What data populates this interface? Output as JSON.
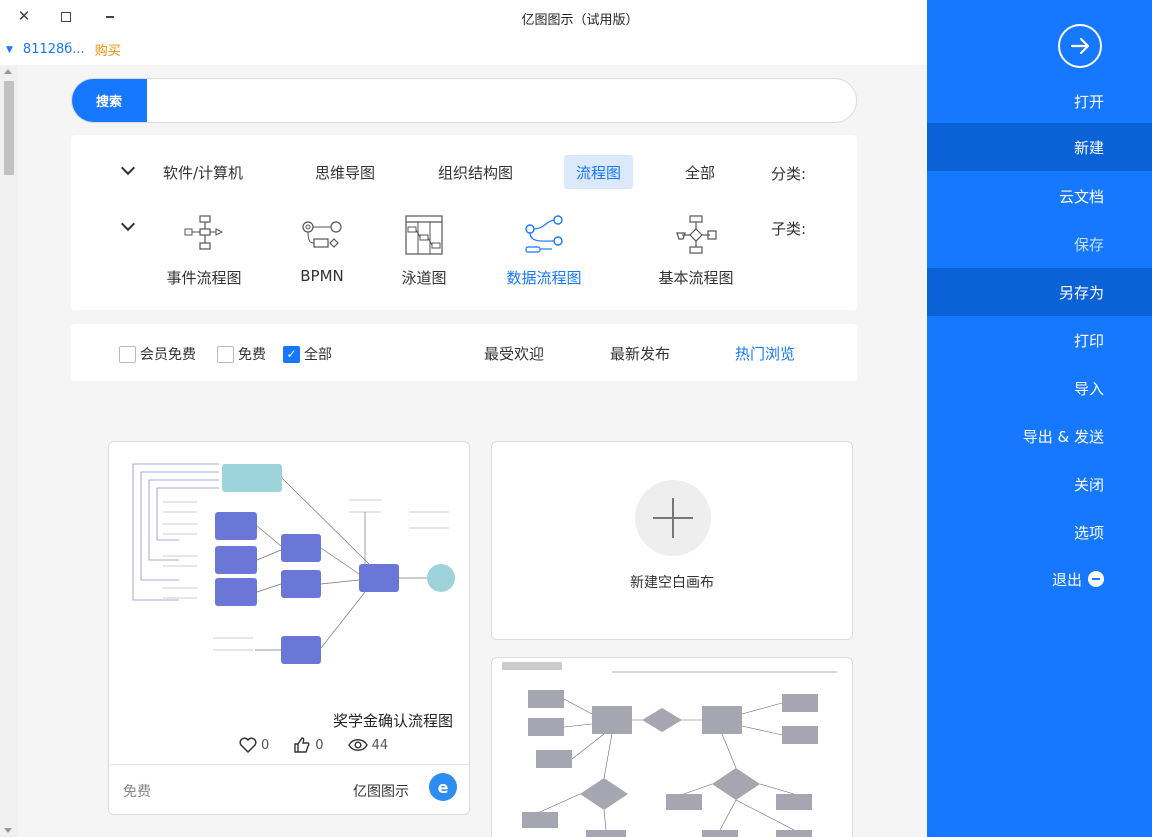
{
  "window": {
    "title": "亿图图示（试用版）",
    "close_symbol": "✕",
    "account": "81128б...",
    "buy": "购买"
  },
  "search": {
    "button": "搜索",
    "placeholder": ""
  },
  "filters": {
    "category_label": "分类:",
    "categories": [
      "全部",
      "流程图",
      "组织结构图",
      "思维导图",
      "软件/计算机"
    ],
    "active_category": "流程图",
    "subcategory_label": "子类:",
    "subcategories": [
      "基本流程图",
      "数据流程图",
      "泳道图",
      "BPMN",
      "事件流程图"
    ],
    "active_subcategory": "数据流程图"
  },
  "sort": {
    "tabs": [
      "热门浏览",
      "最新发布",
      "最受欢迎"
    ],
    "active_tab": "热门浏览",
    "checks": [
      {
        "label": "全部",
        "checked": true
      },
      {
        "label": "免费",
        "checked": false
      },
      {
        "label": "会员免费",
        "checked": false
      }
    ]
  },
  "cards": {
    "new_blank": "新建空白画布",
    "template": {
      "title": "奖学金确认流程图",
      "views": "44",
      "likes": "0",
      "favorites": "0",
      "author": "亿图图示",
      "price": "免费"
    }
  },
  "sidebar": {
    "items": [
      "打开",
      "新建",
      "云文档",
      "保存",
      "另存为",
      "打印",
      "导入",
      "导出 & 发送",
      "关闭",
      "选项",
      "退出"
    ],
    "active": "新建",
    "accent": "#1677ff"
  }
}
